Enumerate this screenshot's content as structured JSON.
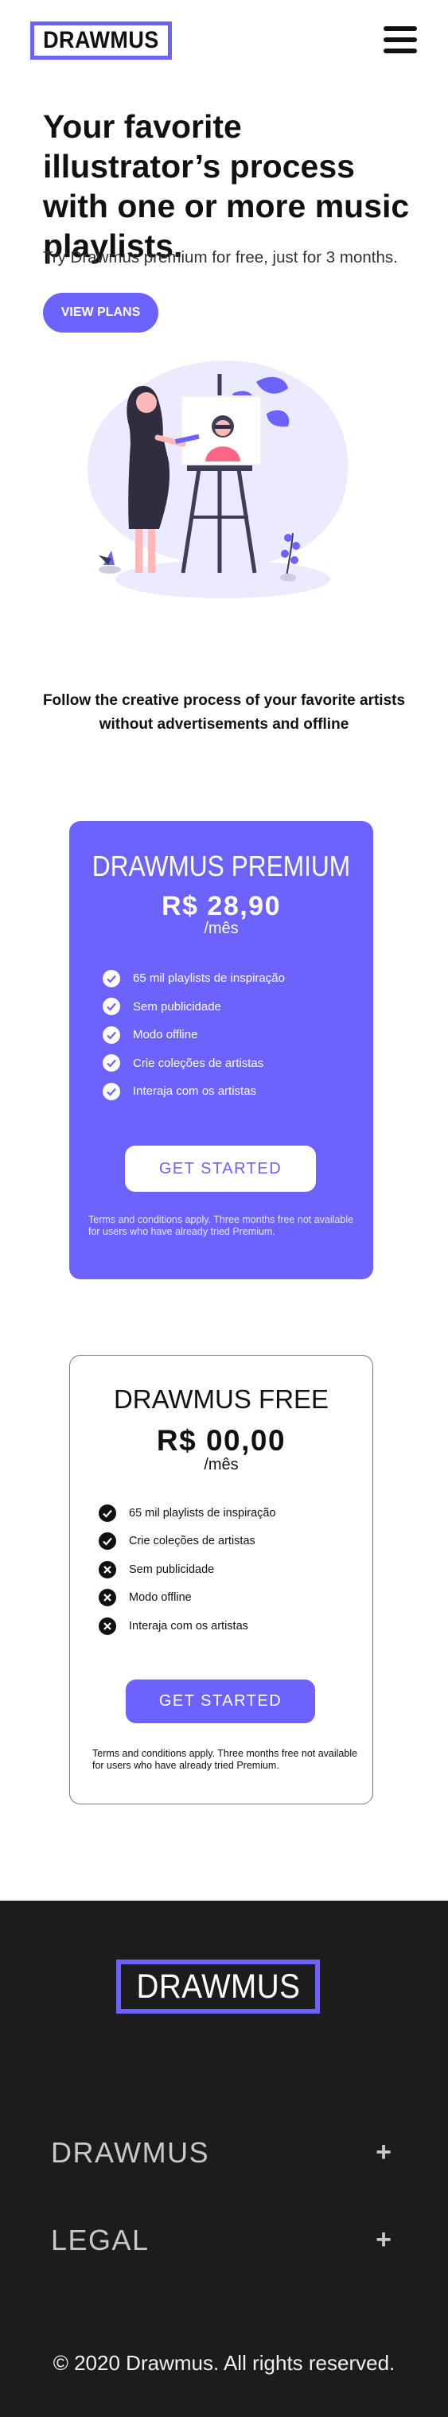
{
  "header": {
    "logo_text": "DRAWMUS",
    "menu_icon": "hamburger-menu-icon"
  },
  "hero": {
    "title": "Your favorite illustrator’s process with one or more music playlists.",
    "subtitle": "Try Drawmus premium for free, just for 3 months.",
    "cta_label": "VIEW PLANS",
    "illustration": "woman-painting-at-easel-illustration"
  },
  "follow_text": "Follow the creative process of your favorite artists without advertisements and offline",
  "plans": {
    "premium": {
      "title": "DRAWMUS PREMIUM",
      "price": "R$ 28,90",
      "period": "/mês",
      "features": [
        {
          "label": "65 mil playlists de inspiração",
          "icon": "check-icon"
        },
        {
          "label": "Sem publicidade",
          "icon": "check-icon"
        },
        {
          "label": "Modo offline",
          "icon": "check-icon"
        },
        {
          "label": "Crie coleções de artistas",
          "icon": "check-icon"
        },
        {
          "label": "Interaja com os artistas",
          "icon": "check-icon"
        }
      ],
      "cta_label": "GET STARTED",
      "terms": "Terms and conditions apply. Three months free not available for users who have already tried Premium."
    },
    "free": {
      "title": "DRAWMUS FREE",
      "price": "R$ 00,00",
      "period": "/mês",
      "features": [
        {
          "label": "65 mil playlists de inspiração",
          "icon": "check-icon"
        },
        {
          "label": "Crie coleções de artistas",
          "icon": "check-icon"
        },
        {
          "label": "Sem publicidade",
          "icon": "x-icon"
        },
        {
          "label": "Modo offline",
          "icon": "x-icon"
        },
        {
          "label": "Interaja com os artistas",
          "icon": "x-icon"
        }
      ],
      "cta_label": "GET STARTED",
      "terms": "Terms and conditions apply. Three months free not available for users who have already tried Premium."
    }
  },
  "footer": {
    "logo_text": "DRAWMUS",
    "sections": [
      {
        "label": "DRAWMUS",
        "icon": "plus-icon"
      },
      {
        "label": "LEGAL",
        "icon": "plus-icon"
      }
    ],
    "plus_symbol": "+",
    "copyright": "© 2020 Drawmus. All rights reserved."
  },
  "colors": {
    "accent": "#6c63ff",
    "footer_bg": "#1c1c1c",
    "text": "#111111",
    "white": "#ffffff"
  }
}
